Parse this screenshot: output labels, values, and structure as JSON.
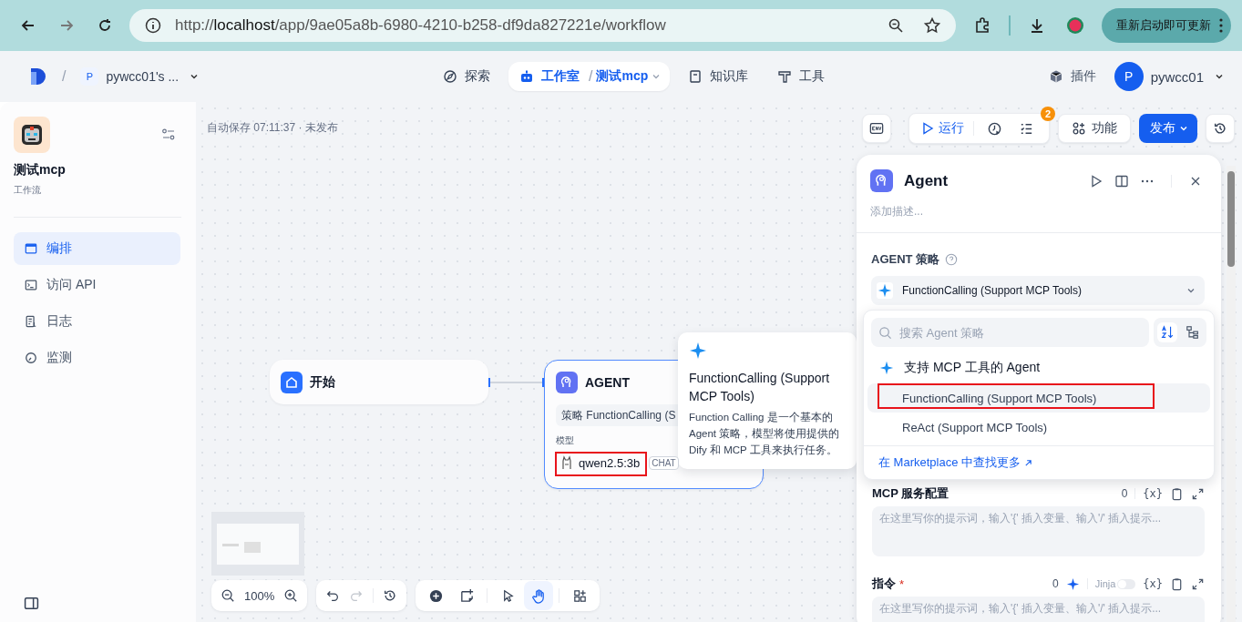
{
  "browser": {
    "scheme": "http://",
    "host": "localhost",
    "path": "/app/9ae05a8b-6980-4210-b258-df9da827221e/workflow",
    "update_button": "重新启动即可更新"
  },
  "header": {
    "breadcrumb_separator": "/",
    "workspace_initial": "P",
    "workspace": "pywcc01's ...",
    "nav": [
      {
        "kind": "explore",
        "label": "探索",
        "selected": false
      },
      {
        "kind": "studio",
        "label": "工作室",
        "separator": "/",
        "app": "测试mcp",
        "selected": true
      },
      {
        "kind": "datasets",
        "label": "知识库",
        "selected": false
      },
      {
        "kind": "tools",
        "label": "工具",
        "selected": false
      }
    ],
    "plugins": "插件",
    "user_initial": "P",
    "user": "pywcc01"
  },
  "sidebar": {
    "app_name": "测试mcp",
    "app_type": "工作流",
    "items": [
      {
        "kind": "orchestrate",
        "label": "编排",
        "selected": true
      },
      {
        "kind": "api",
        "label": "访问 API",
        "selected": false
      },
      {
        "kind": "logs",
        "label": "日志",
        "selected": false
      },
      {
        "kind": "monitor",
        "label": "监测",
        "selected": false
      }
    ]
  },
  "canvas": {
    "autosave": "自动保存 07:11:37 · 未发布",
    "run": "运行",
    "checklist_count": "2",
    "features": "功能",
    "publish": "发布",
    "start_node": {
      "title": "开始"
    },
    "agent_node": {
      "title": "AGENT",
      "strategy": "策略 FunctionCalling (S",
      "model_label": "模型",
      "model": "qwen2.5:3b",
      "model_tag": "CHAT",
      "highlighted": true
    },
    "tooltip": {
      "title": "FunctionCalling (Support MCP Tools)",
      "description": "Function Calling 是一个基本的 Agent 策略，模型将使用提供的 Dify 和 MCP 工具来执行任务。"
    },
    "zoom": "100%",
    "tools": [
      {
        "kind": "add",
        "selected": false
      },
      {
        "kind": "note",
        "selected": false
      },
      {
        "kind": "pointer",
        "selected": false
      },
      {
        "kind": "hand",
        "selected": true
      },
      {
        "kind": "layout",
        "selected": false
      }
    ]
  },
  "panel": {
    "title": "Agent",
    "description_placeholder": "添加描述...",
    "strategy_label": "AGENT 策略",
    "strategy_value": "FunctionCalling (Support MCP Tools)",
    "dropdown": {
      "search_placeholder": "搜索 Agent 策略",
      "provider": "支持 MCP 工具的 Agent",
      "options": [
        {
          "label": "FunctionCalling (Support MCP Tools)",
          "selected": true,
          "highlighted": true
        },
        {
          "label": "ReAct (Support MCP Tools)",
          "selected": false,
          "highlighted": false
        }
      ],
      "marketplace": "在 Marketplace 中查找更多"
    },
    "fields": [
      {
        "kind": "plain",
        "label": "MCP 服务配置",
        "count": "0",
        "variable_button": "{x}",
        "placeholder": "在这里写你的提示词，输入'{' 插入变量、输入'/' 插入提示..."
      },
      {
        "kind": "instruction",
        "label": "指令",
        "required_mark": "*",
        "count": "0",
        "jinja": "Jinja",
        "jinja_on": false,
        "variable_button": "{x}",
        "placeholder": "在这里写你的提示词，输入'{' 插入变量、输入'/' 插入提示..."
      }
    ]
  }
}
